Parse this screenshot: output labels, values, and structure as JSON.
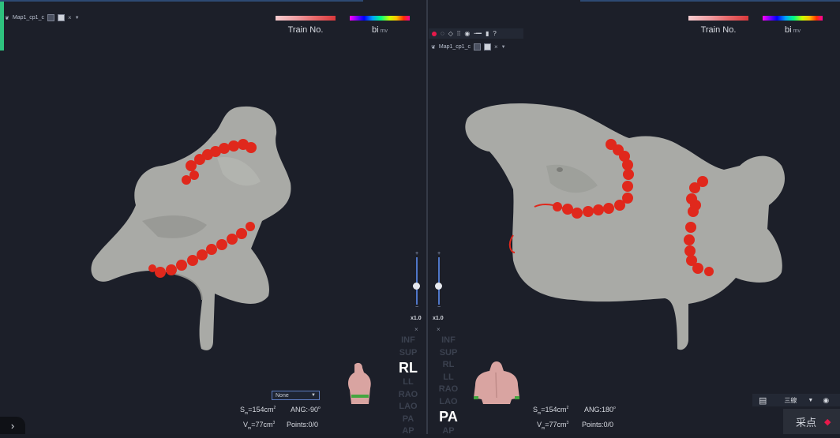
{
  "left_view": {
    "map_tab": "Map1_cp1_c",
    "legend_train": "Train No.",
    "legend_bi": "bi",
    "legend_bi_unit": "mv",
    "zoom": "x1.0",
    "dropdown_value": "None",
    "sm_label": "S",
    "sm_sub": "m",
    "sm_value": "=154cm",
    "sm_sup": "2",
    "vm_label": "V",
    "vm_sub": "m",
    "vm_value": "=77cm",
    "vm_sup": "3",
    "ang": "ANG:-90",
    "ang_deg": "o",
    "points": "Points:0/0",
    "views": [
      "INF",
      "SUP",
      "RL",
      "LL",
      "RAO",
      "LAO",
      "PA",
      "AP"
    ],
    "active_view": "RL"
  },
  "right_view": {
    "map_tab": "Map1_cp1_c",
    "legend_train": "Train No.",
    "legend_bi": "bi",
    "legend_bi_unit": "mv",
    "zoom": "x1.0",
    "sm_label": "S",
    "sm_sub": "m",
    "sm_value": "=154cm",
    "sm_sup": "2",
    "vm_label": "V",
    "vm_sub": "m",
    "vm_value": "=77cm",
    "vm_sup": "3",
    "ang": "ANG:180",
    "ang_deg": "o",
    "points": "Points:0/0",
    "views": [
      "INF",
      "SUP",
      "RL",
      "LL",
      "RAO",
      "LAO",
      "PA",
      "AP"
    ],
    "active_view": "PA"
  },
  "toolbar_icons": [
    "record-dot-icon",
    "lasso-icon",
    "eraser-icon",
    "grid-select-icon",
    "eye-icon",
    "slider-icon",
    "pin-icon",
    "help-icon"
  ],
  "bottom_right": {
    "layout_label": "三線",
    "caidian": "采点"
  },
  "colors": {
    "background": "#1c1f29",
    "model": "#a9aaa6",
    "ablation_point": "#e0281c",
    "accent": "#2ec27e",
    "slider": "#4f76c8"
  }
}
